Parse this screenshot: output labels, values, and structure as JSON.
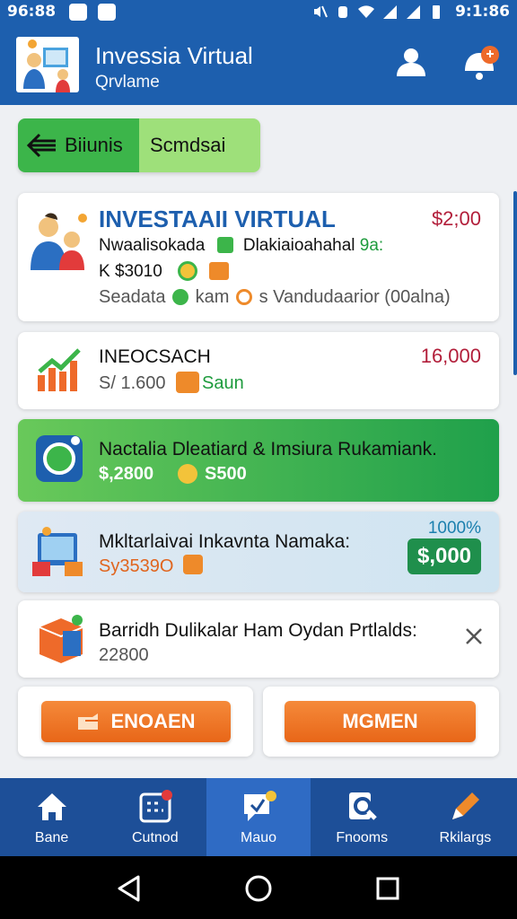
{
  "status_bar": {
    "time_left": "96:88",
    "time_right": "9:1:86"
  },
  "app_bar": {
    "title": "Invessia Virtual",
    "subtitle": "Qrvlame",
    "icons": [
      "user-icon",
      "notification-bell-icon"
    ]
  },
  "tabs": [
    {
      "label": "Biiunis",
      "icon": "back-arrow-icon"
    },
    {
      "label": "Scmdsai"
    }
  ],
  "cards": [
    {
      "heading": "INVESTAAII VIRTUAL",
      "price": "$2;00",
      "line2a": "Nwaalisokada",
      "line2b": "Dlakiaioahahal",
      "line2c": "9a:",
      "line3": "K $3010",
      "line4a": "Seadata",
      "line4b": "kam",
      "line4c": "s Vandudaarior (00alna)"
    },
    {
      "heading": "INEOCSACH",
      "price": "16,000",
      "sub": "S/ 1.600",
      "save": "Saun"
    },
    {
      "heading": "Nactalia Dleatiard & Imsiura Rukamiank.",
      "sub": "$,2800",
      "sub2": "S500"
    },
    {
      "heading": "Mkltarlaivai Inkavnta Namaka:",
      "sub": "Sy3539O",
      "count": "1000%",
      "price_button": "$,000"
    },
    {
      "heading": "Barridh Dulikalar Ham Oydan Prtlalds:",
      "sub": "22800"
    }
  ],
  "actions": {
    "left": "ENOAEN",
    "right": "MGMEN"
  },
  "bottom_nav": [
    {
      "label": "Bane",
      "icon": "home-icon"
    },
    {
      "label": "Cutnod",
      "icon": "calendar-icon"
    },
    {
      "label": "Mauo",
      "icon": "chat-icon",
      "active": true
    },
    {
      "label": "Fnooms",
      "icon": "search-doc-icon"
    },
    {
      "label": "Rkilargs",
      "icon": "edit-icon"
    }
  ],
  "colors": {
    "primary": "#1d5fae",
    "green": "#3cb54a",
    "orange": "#e86618",
    "price_red": "#b21e3a"
  }
}
